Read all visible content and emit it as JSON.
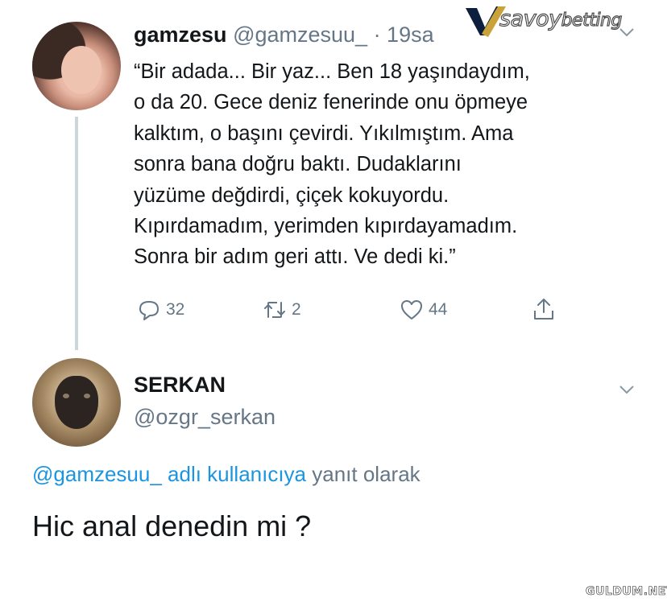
{
  "tweet1": {
    "display_name": "gamzesu",
    "handle": "@gamzesuu_",
    "time": " · 19sa",
    "text_lines": [
      "“Bir adada... Bir yaz... Ben 18 yaşındaydım,",
      "o da 20. Gece deniz fenerinde onu öpmeye",
      "kalktım, o başını çevirdi. Yıkılmıştım. Ama",
      "sonra bana doğru baktı. Dudaklarını",
      "yüzüme değdirdi, çiçek kokuyordu.",
      "Kıpırdamadım, yerimden kıpırdayamadım.",
      "Sonra bir adım geri attı. Ve dedi ki.”"
    ],
    "reply_count": "32",
    "retweet_count": "2",
    "like_count": "44",
    "icons": [
      "reply-icon",
      "retweet-icon",
      "like-icon",
      "share-icon",
      "chevron-down-icon"
    ]
  },
  "logo": {
    "text_main": "savoy",
    "text_light": "betting"
  },
  "tweet2": {
    "display_name": "SERKAN",
    "handle": "@ozgr_serkan",
    "reply_mention": "@gamzesuu_ adlı kullanıcıya",
    "reply_suffix": " yanıt olarak",
    "text": "Hic anal denedin mi ?"
  },
  "watermark": "GULDUM.NET",
  "colors": {
    "text": "#14171a",
    "muted": "#657786",
    "link": "#1b95e0",
    "thread_line": "#ccd6dd"
  }
}
